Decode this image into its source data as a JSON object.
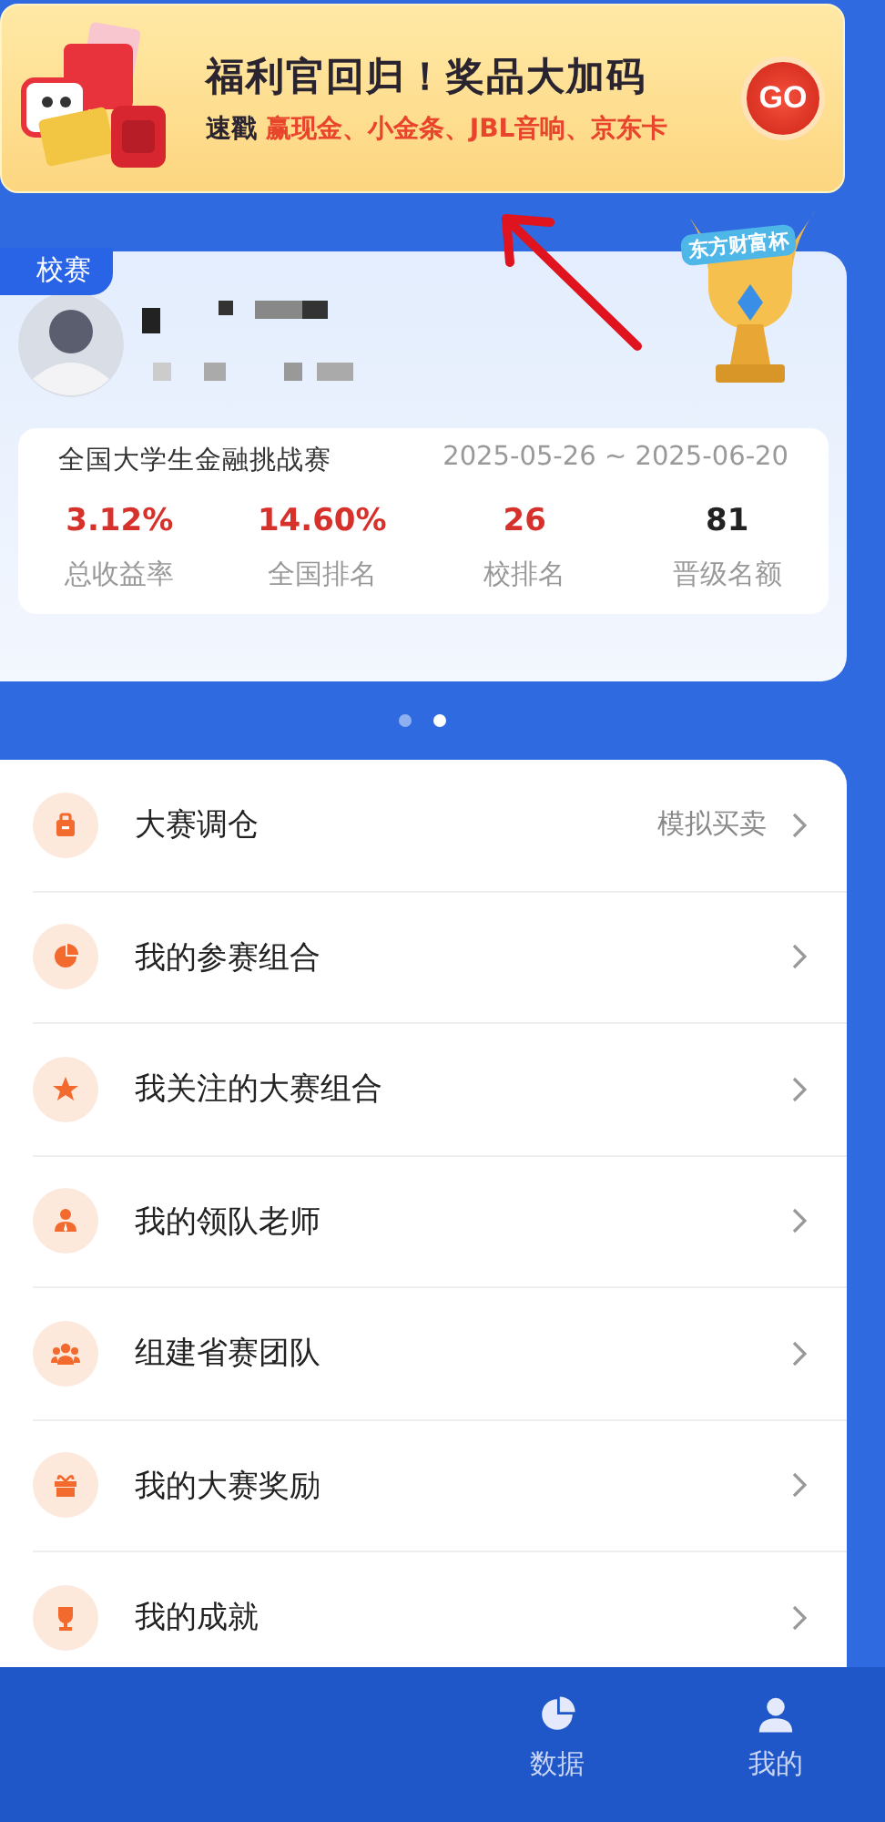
{
  "banner": {
    "title": "福利官回归！奖品大加码",
    "subtitle": "速戳 **赢现金、小金条、JBL音响、京东卡**",
    "button": "GO"
  },
  "contest_card": {
    "tag": "校赛",
    "trophy_label": "东方财富杯",
    "contest": "全国大学生金融挑战赛",
    "period": "2025-05-26 ~ 2025-06-20",
    "stats": [
      {
        "value": "3.12%",
        "label": "总收益率",
        "highlight": true
      },
      {
        "value": "14.60%",
        "label": "全国排名",
        "highlight": true
      },
      {
        "value": "26",
        "label": "校排名",
        "highlight": true
      },
      {
        "value": "81",
        "label": "晋级名额",
        "highlight": false
      }
    ]
  },
  "pager": [
    {
      "selected": false
    },
    {
      "selected": true
    }
  ],
  "menu": [
    {
      "kind": "briefcase",
      "label": "大赛调仓",
      "hint": "模拟买卖"
    },
    {
      "kind": "pie",
      "label": "我的参赛组合"
    },
    {
      "kind": "star",
      "label": "我关注的大赛组合"
    },
    {
      "kind": "teacher",
      "label": "我的领队老师"
    },
    {
      "kind": "team",
      "label": "组建省赛团队"
    },
    {
      "kind": "gift",
      "label": "我的大赛奖励"
    },
    {
      "kind": "trophy",
      "label": "我的成就"
    }
  ],
  "tab_bar": [
    {
      "kind": "pie",
      "label": "数据",
      "selected": false
    },
    {
      "kind": "person",
      "label": "我的",
      "selected": false
    }
  ]
}
